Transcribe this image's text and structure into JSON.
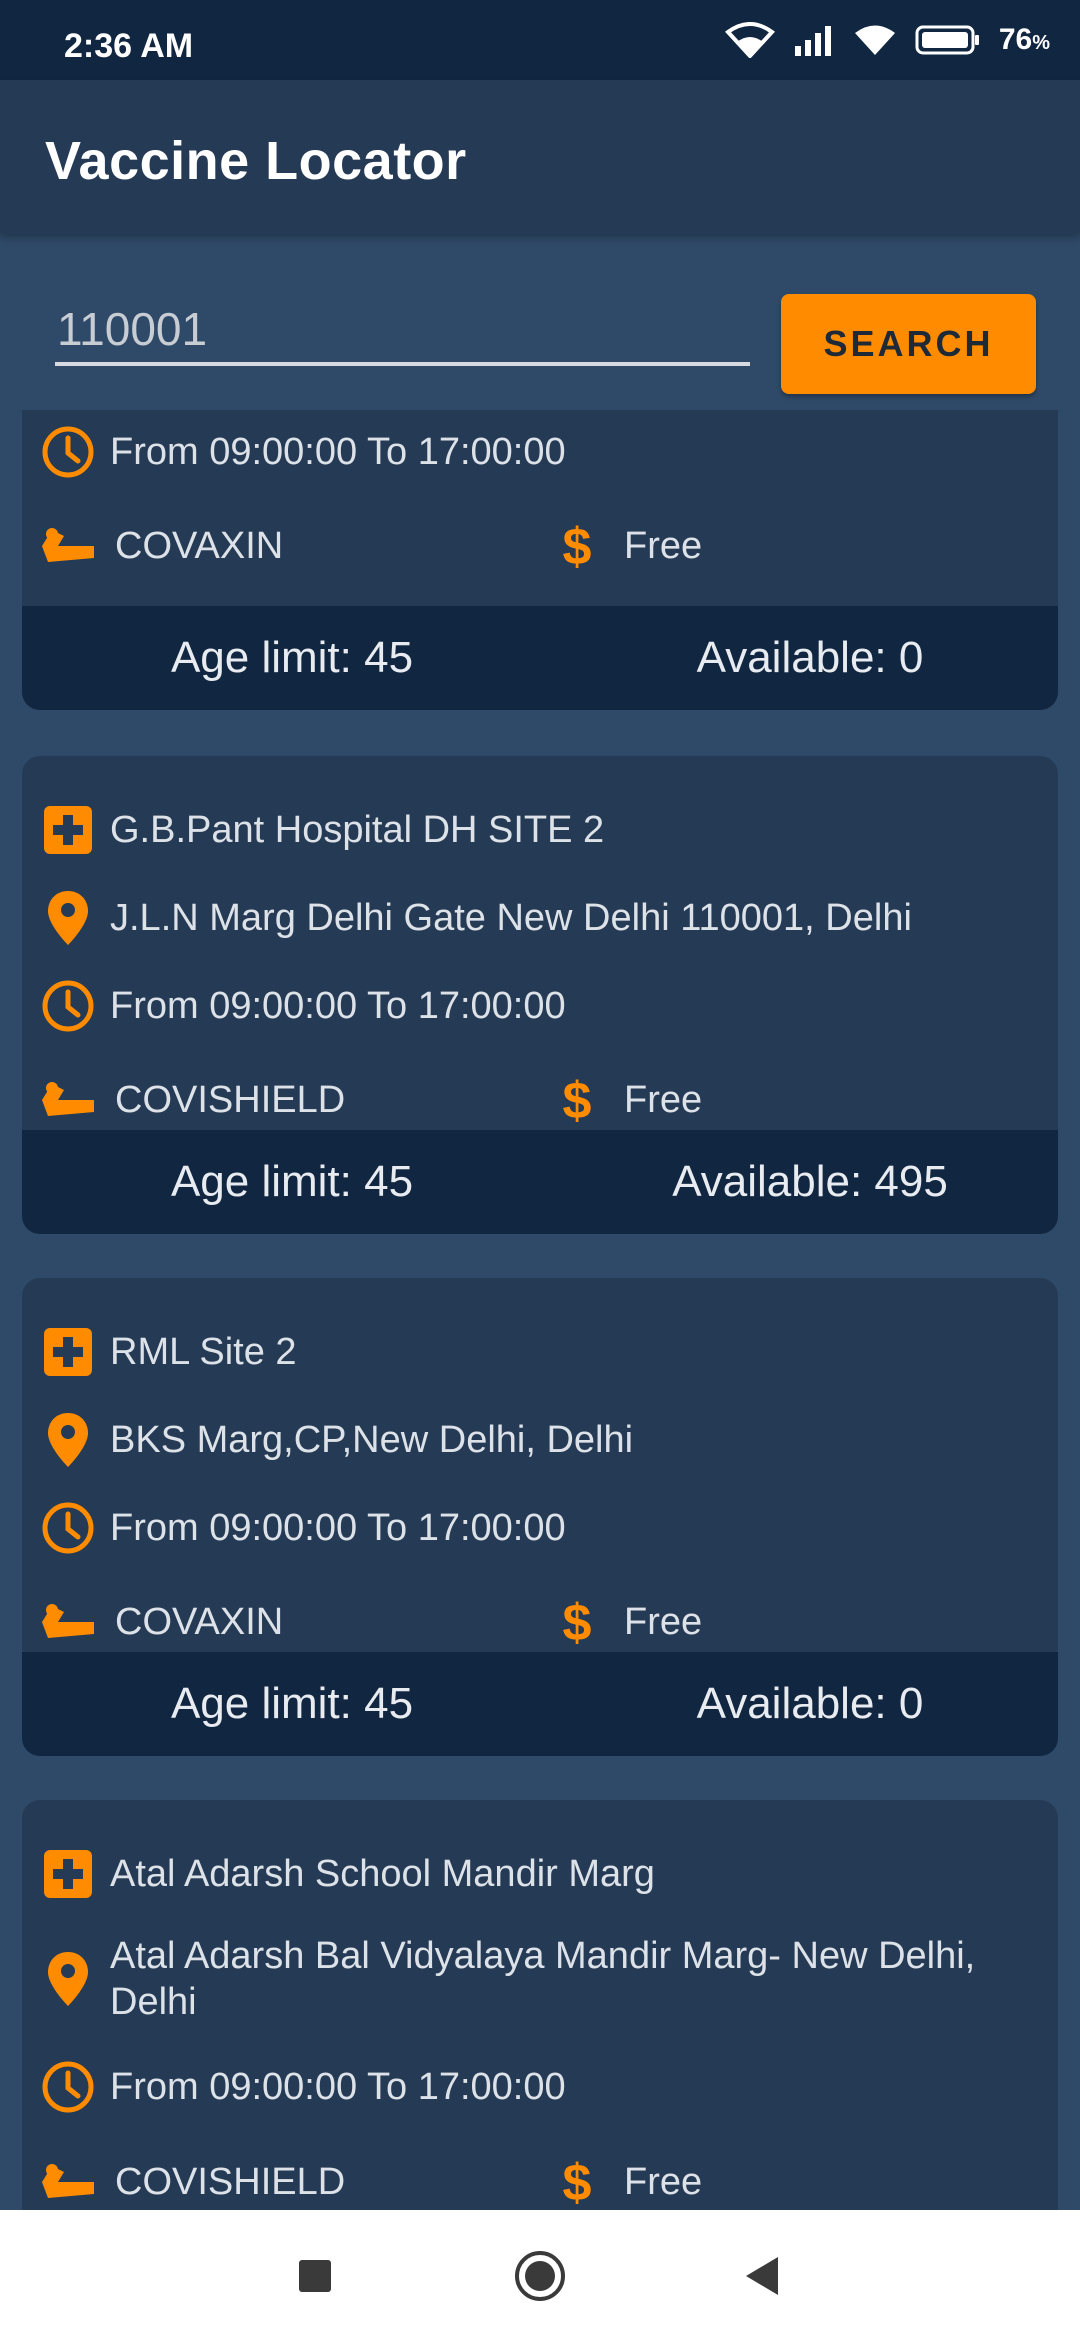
{
  "status": {
    "time": "2:36 AM",
    "battery": "76",
    "battery_unit": "%"
  },
  "app": {
    "title": "Vaccine Locator"
  },
  "search": {
    "value": "110001",
    "button_label": "SEARCH"
  },
  "icons": {
    "center": "hospital-plus-icon",
    "address": "location-pin-icon",
    "time": "clock-icon",
    "vaccine": "vaccine-icon",
    "fee": "dollar-icon"
  },
  "colors": {
    "accent": "#ff8c00",
    "background": "#2f4a68",
    "card": "#253a55",
    "dark": "#112640"
  },
  "centers": [
    {
      "time": "From 09:00:00 To 17:00:00",
      "vaccine": "COVAXIN",
      "fee": "Free",
      "age_limit": "Age limit: 45",
      "available": "Available: 0"
    },
    {
      "name": "G.B.Pant Hospital DH SITE 2",
      "address": "J.L.N Marg Delhi Gate New Delhi 110001, Delhi",
      "time": "From 09:00:00 To 17:00:00",
      "vaccine": "COVISHIELD",
      "fee": "Free",
      "age_limit": "Age limit: 45",
      "available": "Available: 495"
    },
    {
      "name": "RML Site 2",
      "address": "BKS Marg,CP,New Delhi, Delhi",
      "time": "From 09:00:00 To 17:00:00",
      "vaccine": "COVAXIN",
      "fee": "Free",
      "age_limit": "Age limit: 45",
      "available": "Available: 0"
    },
    {
      "name": "Atal Adarsh School Mandir Marg",
      "address": "Atal Adarsh Bal Vidyalaya Mandir Marg- New Delhi, Delhi",
      "time": "From 09:00:00 To 17:00:00",
      "vaccine": "COVISHIELD",
      "fee": "Free"
    }
  ]
}
